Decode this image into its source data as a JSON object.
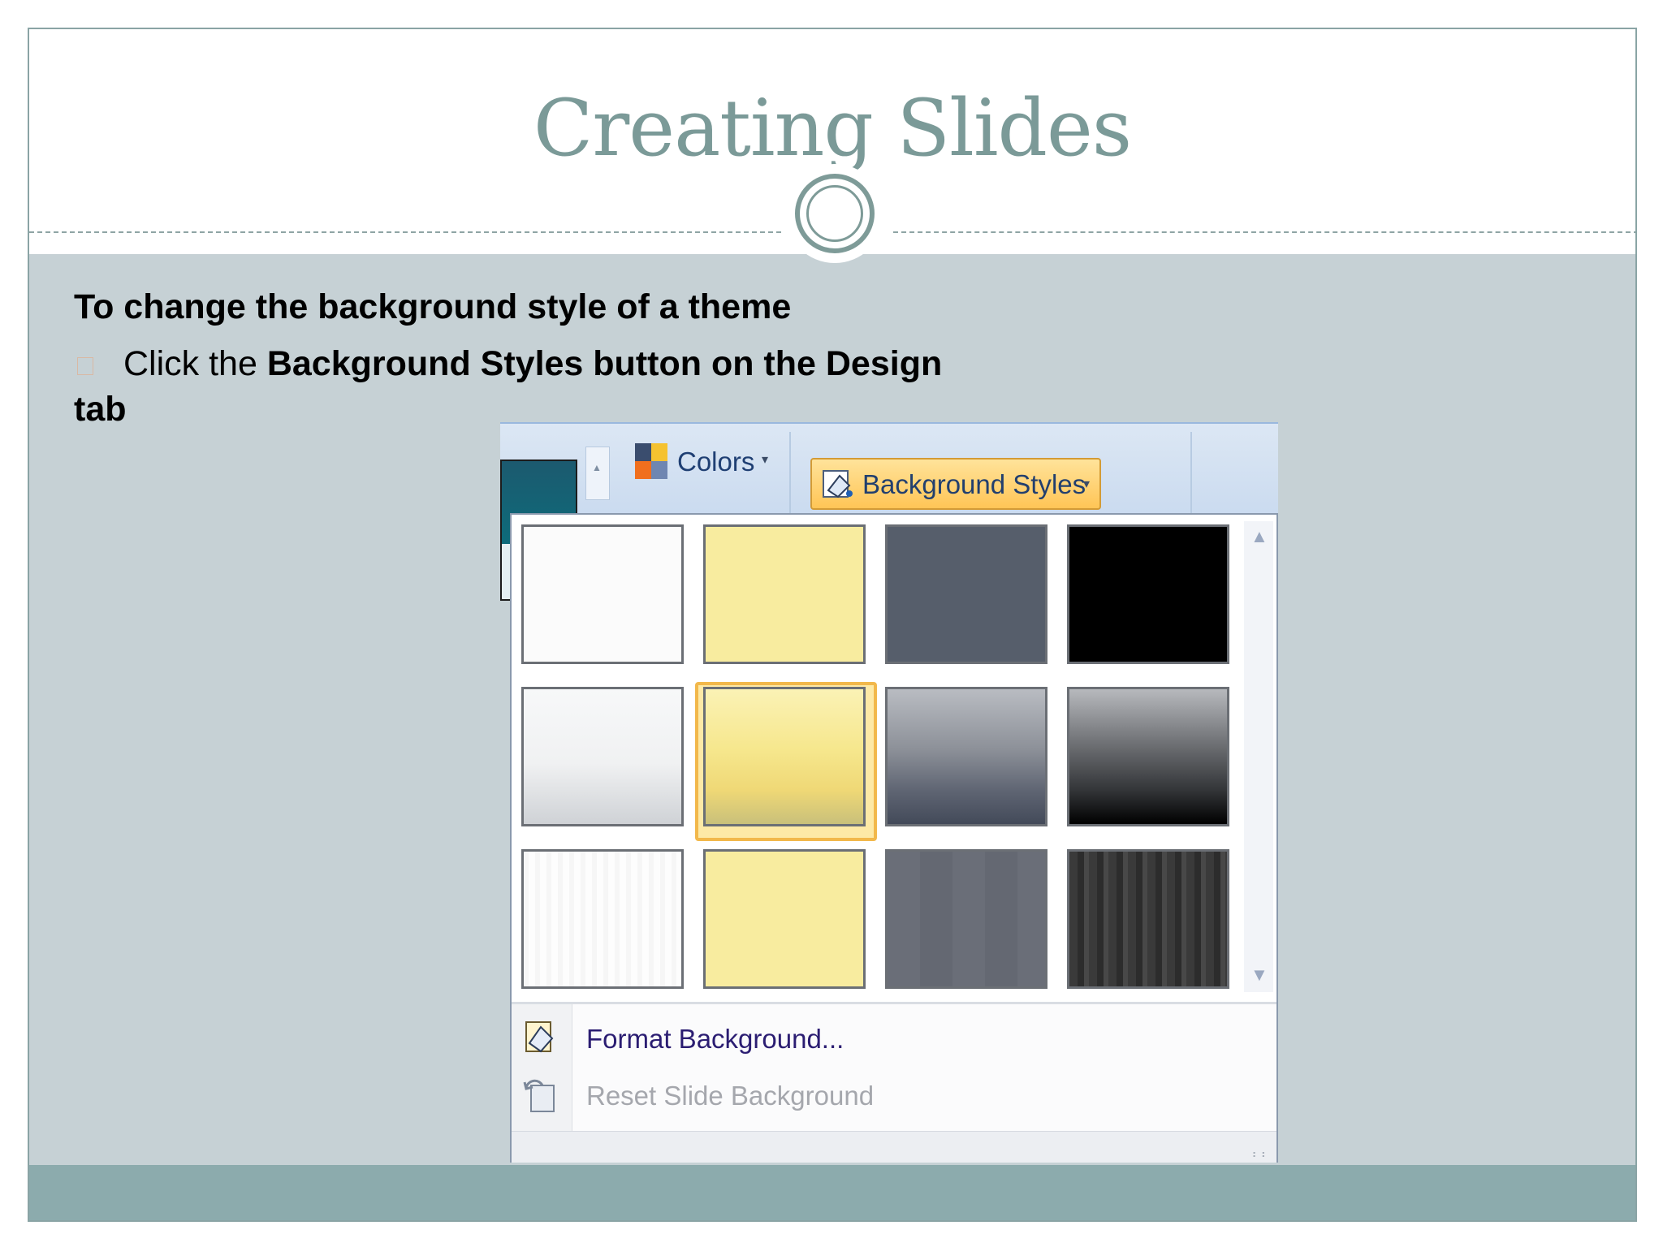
{
  "slide": {
    "title": "Creating Slides",
    "heading": "To change the background style of a  theme",
    "bullet": {
      "prefix": "Click the ",
      "bold": "Background Styles button on the Design",
      "tail": "tab"
    }
  },
  "ribbon": {
    "colors_label": "Colors",
    "background_styles_label": "Background Styles",
    "dropdown_glyph": "▾"
  },
  "gallery": {
    "tiles": [
      {
        "fill": "#fbfbfb"
      },
      {
        "fill": "#f8ec9f"
      },
      {
        "fill": "#565e6b"
      },
      {
        "fill": "#000000"
      },
      {
        "fill": "linear-gradient(#f7f8f9,#f0f1f2 55%,#cfd2d6)"
      },
      {
        "fill": "linear-gradient(#fbf2b5,#f6e78d 45%,#efd876 75%,#c9c07a)"
      },
      {
        "fill": "linear-gradient(#b9bcc2,#8c9098 45%,#5f6573 75%,#434a59)"
      },
      {
        "fill": "linear-gradient(#b7b9bd,#6f7175 40%,#333538 75%,#000)"
      },
      {
        "fill": "repeating-linear-gradient(90deg,#f6f6f6 0 6px,#fdfdfd 6px 14px)"
      },
      {
        "fill": "#f8ec9f"
      },
      {
        "fill": "repeating-linear-gradient(90deg,#6a6e78 0 40px,#646872 40px 80px)"
      },
      {
        "fill": "repeating-linear-gradient(90deg,#3a3a3a 0 10px,#2c2c2c 10px 18px,#484848 18px 24px)"
      }
    ],
    "selected_index": 5
  },
  "menu": {
    "format_background": "Format Background...",
    "reset_background": "Reset Slide Background"
  }
}
